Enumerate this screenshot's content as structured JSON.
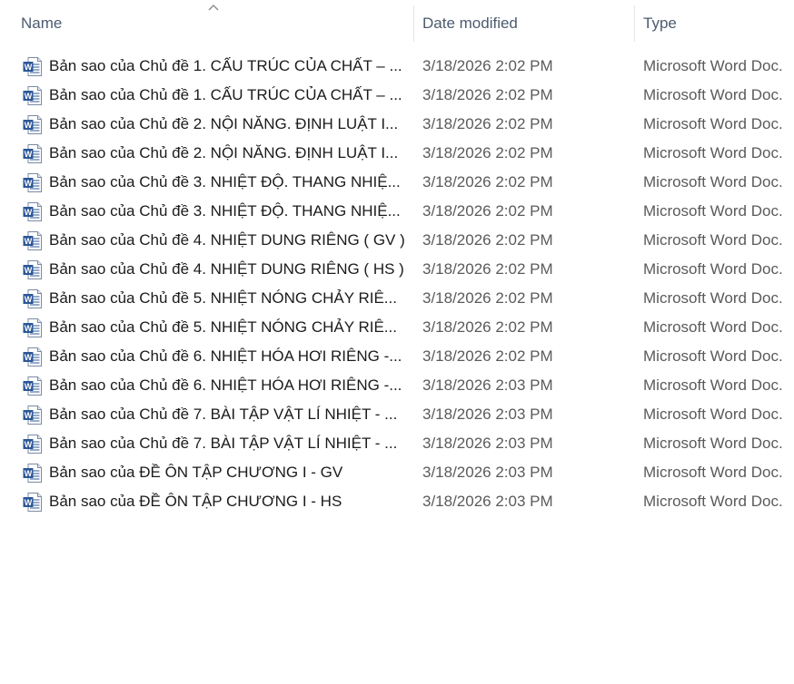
{
  "header": {
    "name_label": "Name",
    "date_label": "Date modified",
    "type_label": "Type",
    "sort_indicator": "chevron-up-icon"
  },
  "files": [
    {
      "name": "Bản sao của Chủ đề 1. CẤU TRÚC CỦA CHẤT – ...",
      "date": "3/18/2026 2:02 PM",
      "type": "Microsoft Word Doc.",
      "icon": "word-document-icon"
    },
    {
      "name": "Bản sao của Chủ đề 1. CẤU TRÚC CỦA CHẤT – ...",
      "date": "3/18/2026 2:02 PM",
      "type": "Microsoft Word Doc.",
      "icon": "word-document-icon"
    },
    {
      "name": "Bản sao của Chủ đề 2. NỘI NĂNG. ĐỊNH LUẬT I...",
      "date": "3/18/2026 2:02 PM",
      "type": "Microsoft Word Doc.",
      "icon": "word-document-icon"
    },
    {
      "name": "Bản sao của Chủ đề 2. NỘI NĂNG. ĐỊNH LUẬT I...",
      "date": "3/18/2026 2:02 PM",
      "type": "Microsoft Word Doc.",
      "icon": "word-document-icon"
    },
    {
      "name": "Bản sao của Chủ đề 3. NHIỆT ĐỘ. THANG NHIỆ...",
      "date": "3/18/2026 2:02 PM",
      "type": "Microsoft Word Doc.",
      "icon": "word-document-icon"
    },
    {
      "name": "Bản sao của Chủ đề 3. NHIỆT ĐỘ. THANG NHIỆ...",
      "date": "3/18/2026 2:02 PM",
      "type": "Microsoft Word Doc.",
      "icon": "word-document-icon"
    },
    {
      "name": "Bản sao của Chủ đề 4. NHIỆT DUNG RIÊNG ( GV )",
      "date": "3/18/2026 2:02 PM",
      "type": "Microsoft Word Doc.",
      "icon": "word-document-icon"
    },
    {
      "name": "Bản sao của Chủ đề 4. NHIỆT DUNG RIÊNG ( HS )",
      "date": "3/18/2026 2:02 PM",
      "type": "Microsoft Word Doc.",
      "icon": "word-document-icon"
    },
    {
      "name": "Bản sao của Chủ đề 5. NHIỆT NÓNG CHẢY RIÊ...",
      "date": "3/18/2026 2:02 PM",
      "type": "Microsoft Word Doc.",
      "icon": "word-document-icon"
    },
    {
      "name": "Bản sao của Chủ đề 5. NHIỆT NÓNG CHẢY RIÊ...",
      "date": "3/18/2026 2:02 PM",
      "type": "Microsoft Word Doc.",
      "icon": "word-document-icon"
    },
    {
      "name": "Bản sao của Chủ đề 6. NHIỆT HÓA HƠI RIÊNG -...",
      "date": "3/18/2026 2:02 PM",
      "type": "Microsoft Word Doc.",
      "icon": "word-document-icon"
    },
    {
      "name": "Bản sao của Chủ đề 6. NHIỆT HÓA HƠI RIÊNG -...",
      "date": "3/18/2026 2:03 PM",
      "type": "Microsoft Word Doc.",
      "icon": "word-document-icon"
    },
    {
      "name": "Bản sao của Chủ đề 7. BÀI TẬP VẬT LÍ NHIỆT - ...",
      "date": "3/18/2026 2:03 PM",
      "type": "Microsoft Word Doc.",
      "icon": "word-document-icon"
    },
    {
      "name": "Bản sao của Chủ đề 7. BÀI TẬP VẬT LÍ NHIỆT - ...",
      "date": "3/18/2026 2:03 PM",
      "type": "Microsoft Word Doc.",
      "icon": "word-document-icon"
    },
    {
      "name": "Bản sao của ĐỀ ÔN TẬP CHƯƠNG I - GV",
      "date": "3/18/2026 2:03 PM",
      "type": "Microsoft Word Doc.",
      "icon": "word-document-icon"
    },
    {
      "name": "Bản sao của ĐỀ ÔN TẬP CHƯƠNG I - HS",
      "date": "3/18/2026 2:03 PM",
      "type": "Microsoft Word Doc.",
      "icon": "word-document-icon"
    }
  ],
  "colors": {
    "header_text": "#4c5b70",
    "word_blue": "#2b5797",
    "cell_text": "#5a5a5a"
  }
}
